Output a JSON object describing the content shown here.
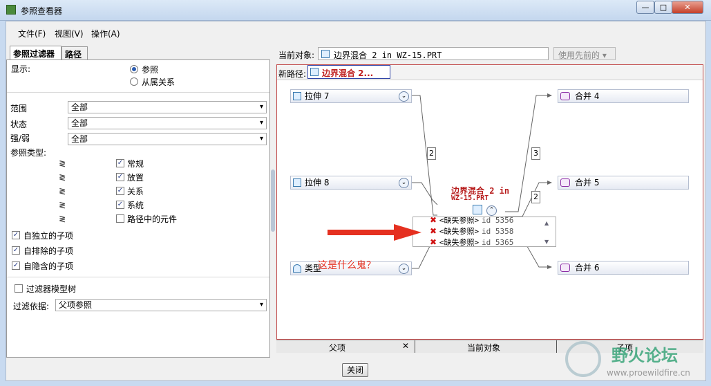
{
  "window": {
    "title": "参照查看器"
  },
  "menu": [
    "文件(F)",
    "视图(V)",
    "操作(A)"
  ],
  "left_tabs": [
    "参照过滤器",
    "路径"
  ],
  "filter": {
    "display_label": "显示:",
    "radio_ref": "参照",
    "radio_dep": "从属关系",
    "scope_label": "范围",
    "scope_value": "全部",
    "state_label": "状态",
    "state_value": "全部",
    "strength_label": "强/弱",
    "strength_value": "全部",
    "reftype_label": "参照类型:",
    "reftypes": [
      "常规",
      "放置",
      "关系",
      "系统",
      "路径中的元件"
    ],
    "zz_glyph": "≷",
    "child_independent": "自独立的子项",
    "child_excluded": "自排除的子项",
    "child_included": "自隐含的子项",
    "filter_tree": "过滤器模型树",
    "filter_by_label": "过滤依据:",
    "filter_by_value": "父项参照"
  },
  "current_object": {
    "label": "当前对象:",
    "value": "边界混合 2 in WZ-15.PRT",
    "use_prev": "使用先前的"
  },
  "newpath": {
    "label": "新路径:",
    "value": "边界混合 2..."
  },
  "graph": {
    "left_nodes": [
      {
        "label": "拉伸 7"
      },
      {
        "label": "拉伸 8"
      },
      {
        "label": "类型"
      }
    ],
    "right_nodes": [
      {
        "label": "合并 4"
      },
      {
        "label": "合并 5"
      },
      {
        "label": "合并 6"
      }
    ],
    "center_title1": "边界混合 2 in",
    "center_title2": "WZ-15.PRT",
    "missing_items": [
      {
        "text": "<缺失参照>",
        "id": "id 5356"
      },
      {
        "text": "<缺失参照>",
        "id": "id 5358"
      },
      {
        "text": "<缺失参照>",
        "id": "id 5365"
      }
    ],
    "counts": {
      "left": "2",
      "right_top": "3",
      "right_mid": "2"
    },
    "annotation": "这是什么鬼？"
  },
  "bottom_tabs": [
    "父项",
    "当前对象",
    "子项"
  ],
  "close_button": "关闭",
  "watermark": {
    "title": "野火论坛",
    "url": "www.proewildfire.cn"
  }
}
